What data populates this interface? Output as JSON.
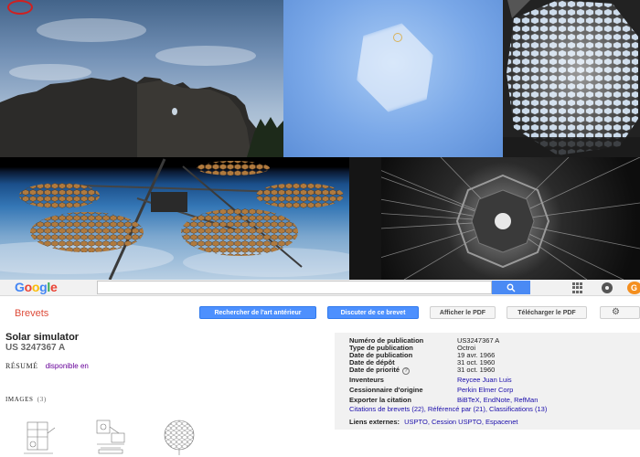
{
  "google_bar": {
    "logo_letters": [
      {
        "ch": "G",
        "color": "#4285f4"
      },
      {
        "ch": "o",
        "color": "#ea4335"
      },
      {
        "ch": "o",
        "color": "#fbbc05"
      },
      {
        "ch": "g",
        "color": "#4285f4"
      },
      {
        "ch": "l",
        "color": "#34a853"
      },
      {
        "ch": "e",
        "color": "#ea4335"
      }
    ],
    "search_value": "",
    "search_icon": "magnifier-icon",
    "apps_icon": "apps-grid-icon",
    "account_icon": "circle-icon",
    "avatar_initial": "G"
  },
  "toolbar": {
    "section": "Brevets",
    "prior_art_label": "Rechercher de l'art antérieur",
    "discuss_label": "Discuter de ce brevet",
    "view_pdf_label": "Afficher le PDF",
    "download_pdf_label": "Télécharger le PDF",
    "settings_icon": "gear-icon"
  },
  "patent": {
    "title": "Solar simulator",
    "number": "US 3247367 A",
    "abstract_label": "RÉSUMÉ",
    "abstract_value": "disponible en",
    "images_label": "IMAGES",
    "images_count": "(3)"
  },
  "info": {
    "pub_number_label": "Numéro de publication",
    "pub_number": "US3247367 A",
    "pub_type_label": "Type de publication",
    "pub_type": "Octroi",
    "pub_date_label": "Date de publication",
    "pub_date": "19 avr. 1966",
    "filing_date_label": "Date de dépôt",
    "filing_date": "31 oct. 1960",
    "priority_date_label": "Date de priorité",
    "priority_date": "31 oct. 1960",
    "inventors_label": "Inventeurs",
    "inventors": "Reycee Juan Luis",
    "assignee_label": "Cessionnaire d'origine",
    "assignee": "Perkin Elmer Corp",
    "export_label": "Exporter la citation",
    "export_links": "BiBTeX, EndNote, RefMan",
    "citations_line": "Citations de brevets (22), Référencé par (21), Classifications (13)",
    "external_label": "Liens externes:",
    "external_links": "USPTO, Cession USPTO, Espacenet"
  }
}
